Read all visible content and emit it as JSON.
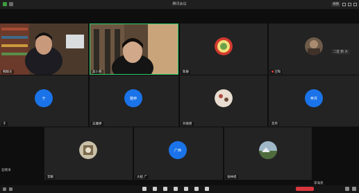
{
  "window": {
    "title": "腾讯会议",
    "view_label": "视图"
  },
  "tiles": [
    {
      "name": "韩辉文"
    },
    {
      "name": "高小燕"
    },
    {
      "name": "陈静"
    },
    {
      "name": "王陶"
    },
    {
      "name": "于"
    },
    {
      "name": "吴雅婷"
    },
    {
      "name": "孙丽君"
    },
    {
      "name": "奔月"
    },
    {
      "name": "李颖"
    },
    {
      "name": "石晓洋"
    },
    {
      "name": "大姐 广"
    },
    {
      "name": "李海英"
    },
    {
      "name": "张林旭"
    }
  ],
  "avatars": {
    "t5": "于",
    "t6": "雅婷",
    "t8": "奔月",
    "t11": "广西"
  },
  "chat_chip": "二区 鸦 大",
  "colors": {
    "accent_blue": "#1a73e8",
    "speaking_green": "#2fd06b",
    "leave_red": "#d9363e"
  }
}
